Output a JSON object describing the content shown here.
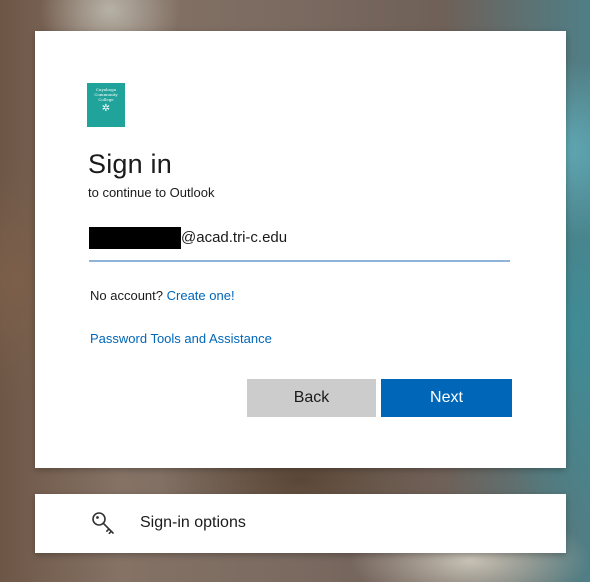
{
  "branding": {
    "logo_text": "Cuyahoga Community College",
    "logo_icon": "sun-icon",
    "accent_color": "#20a39a"
  },
  "signin": {
    "title": "Sign in",
    "subtitle": "to continue to Outlook",
    "email_value": "@acad.tri-c.edu",
    "no_account_text": "No account?",
    "create_link": "Create one!",
    "password_tools_link": "Password Tools and Assistance",
    "back_label": "Back",
    "next_label": "Next",
    "link_color": "#0067b8",
    "primary_button_color": "#0067b8"
  },
  "options": {
    "label": "Sign-in options",
    "icon": "key-icon"
  }
}
